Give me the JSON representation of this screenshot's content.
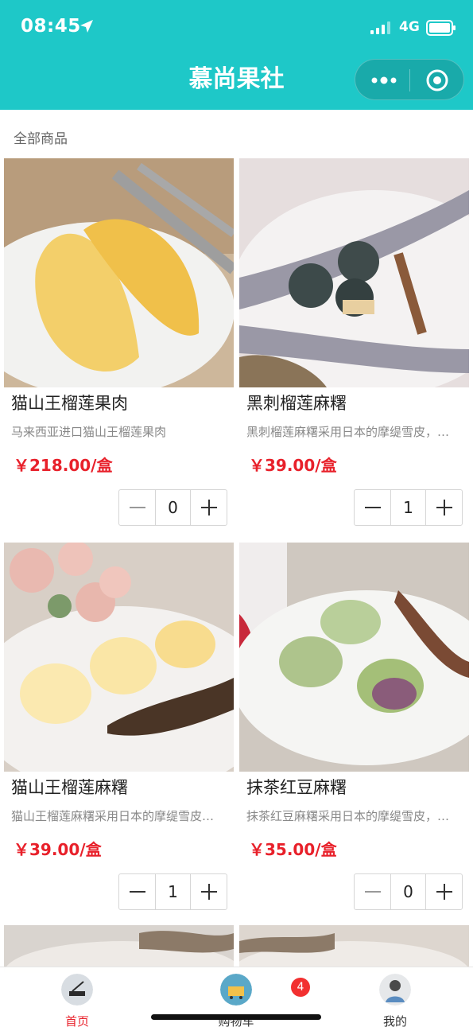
{
  "status_bar": {
    "time": "08:45",
    "network": "4G"
  },
  "nav": {
    "title": "慕尚果社"
  },
  "section": {
    "label": "全部商品"
  },
  "products": [
    {
      "name": "猫山王榴莲果肉",
      "desc": "马来西亚进口猫山王榴莲果肉",
      "price": "￥218.00/盒",
      "qty": "0"
    },
    {
      "name": "黑刺榴莲麻糬",
      "desc": "黑刺榴莲麻糬采用日本的摩缇雪皮，…",
      "price": "￥39.00/盒",
      "qty": "1"
    },
    {
      "name": "猫山王榴莲麻糬",
      "desc": "猫山王榴莲麻糬采用日本的摩缇雪皮…",
      "price": "￥39.00/盒",
      "qty": "1"
    },
    {
      "name": "抹茶红豆麻糬",
      "desc": "抹茶红豆麻糬采用日本的摩缇雪皮，…",
      "price": "￥35.00/盒",
      "qty": "0"
    }
  ],
  "tabbar": {
    "tabs": [
      {
        "label": "首页",
        "active": true
      },
      {
        "label": "购物车",
        "active": false
      },
      {
        "label": "我的",
        "active": false
      }
    ],
    "cart_badge": "4"
  },
  "colors": {
    "brand": "#1ec8c8",
    "price": "#e8202a",
    "badge": "#f23030"
  }
}
